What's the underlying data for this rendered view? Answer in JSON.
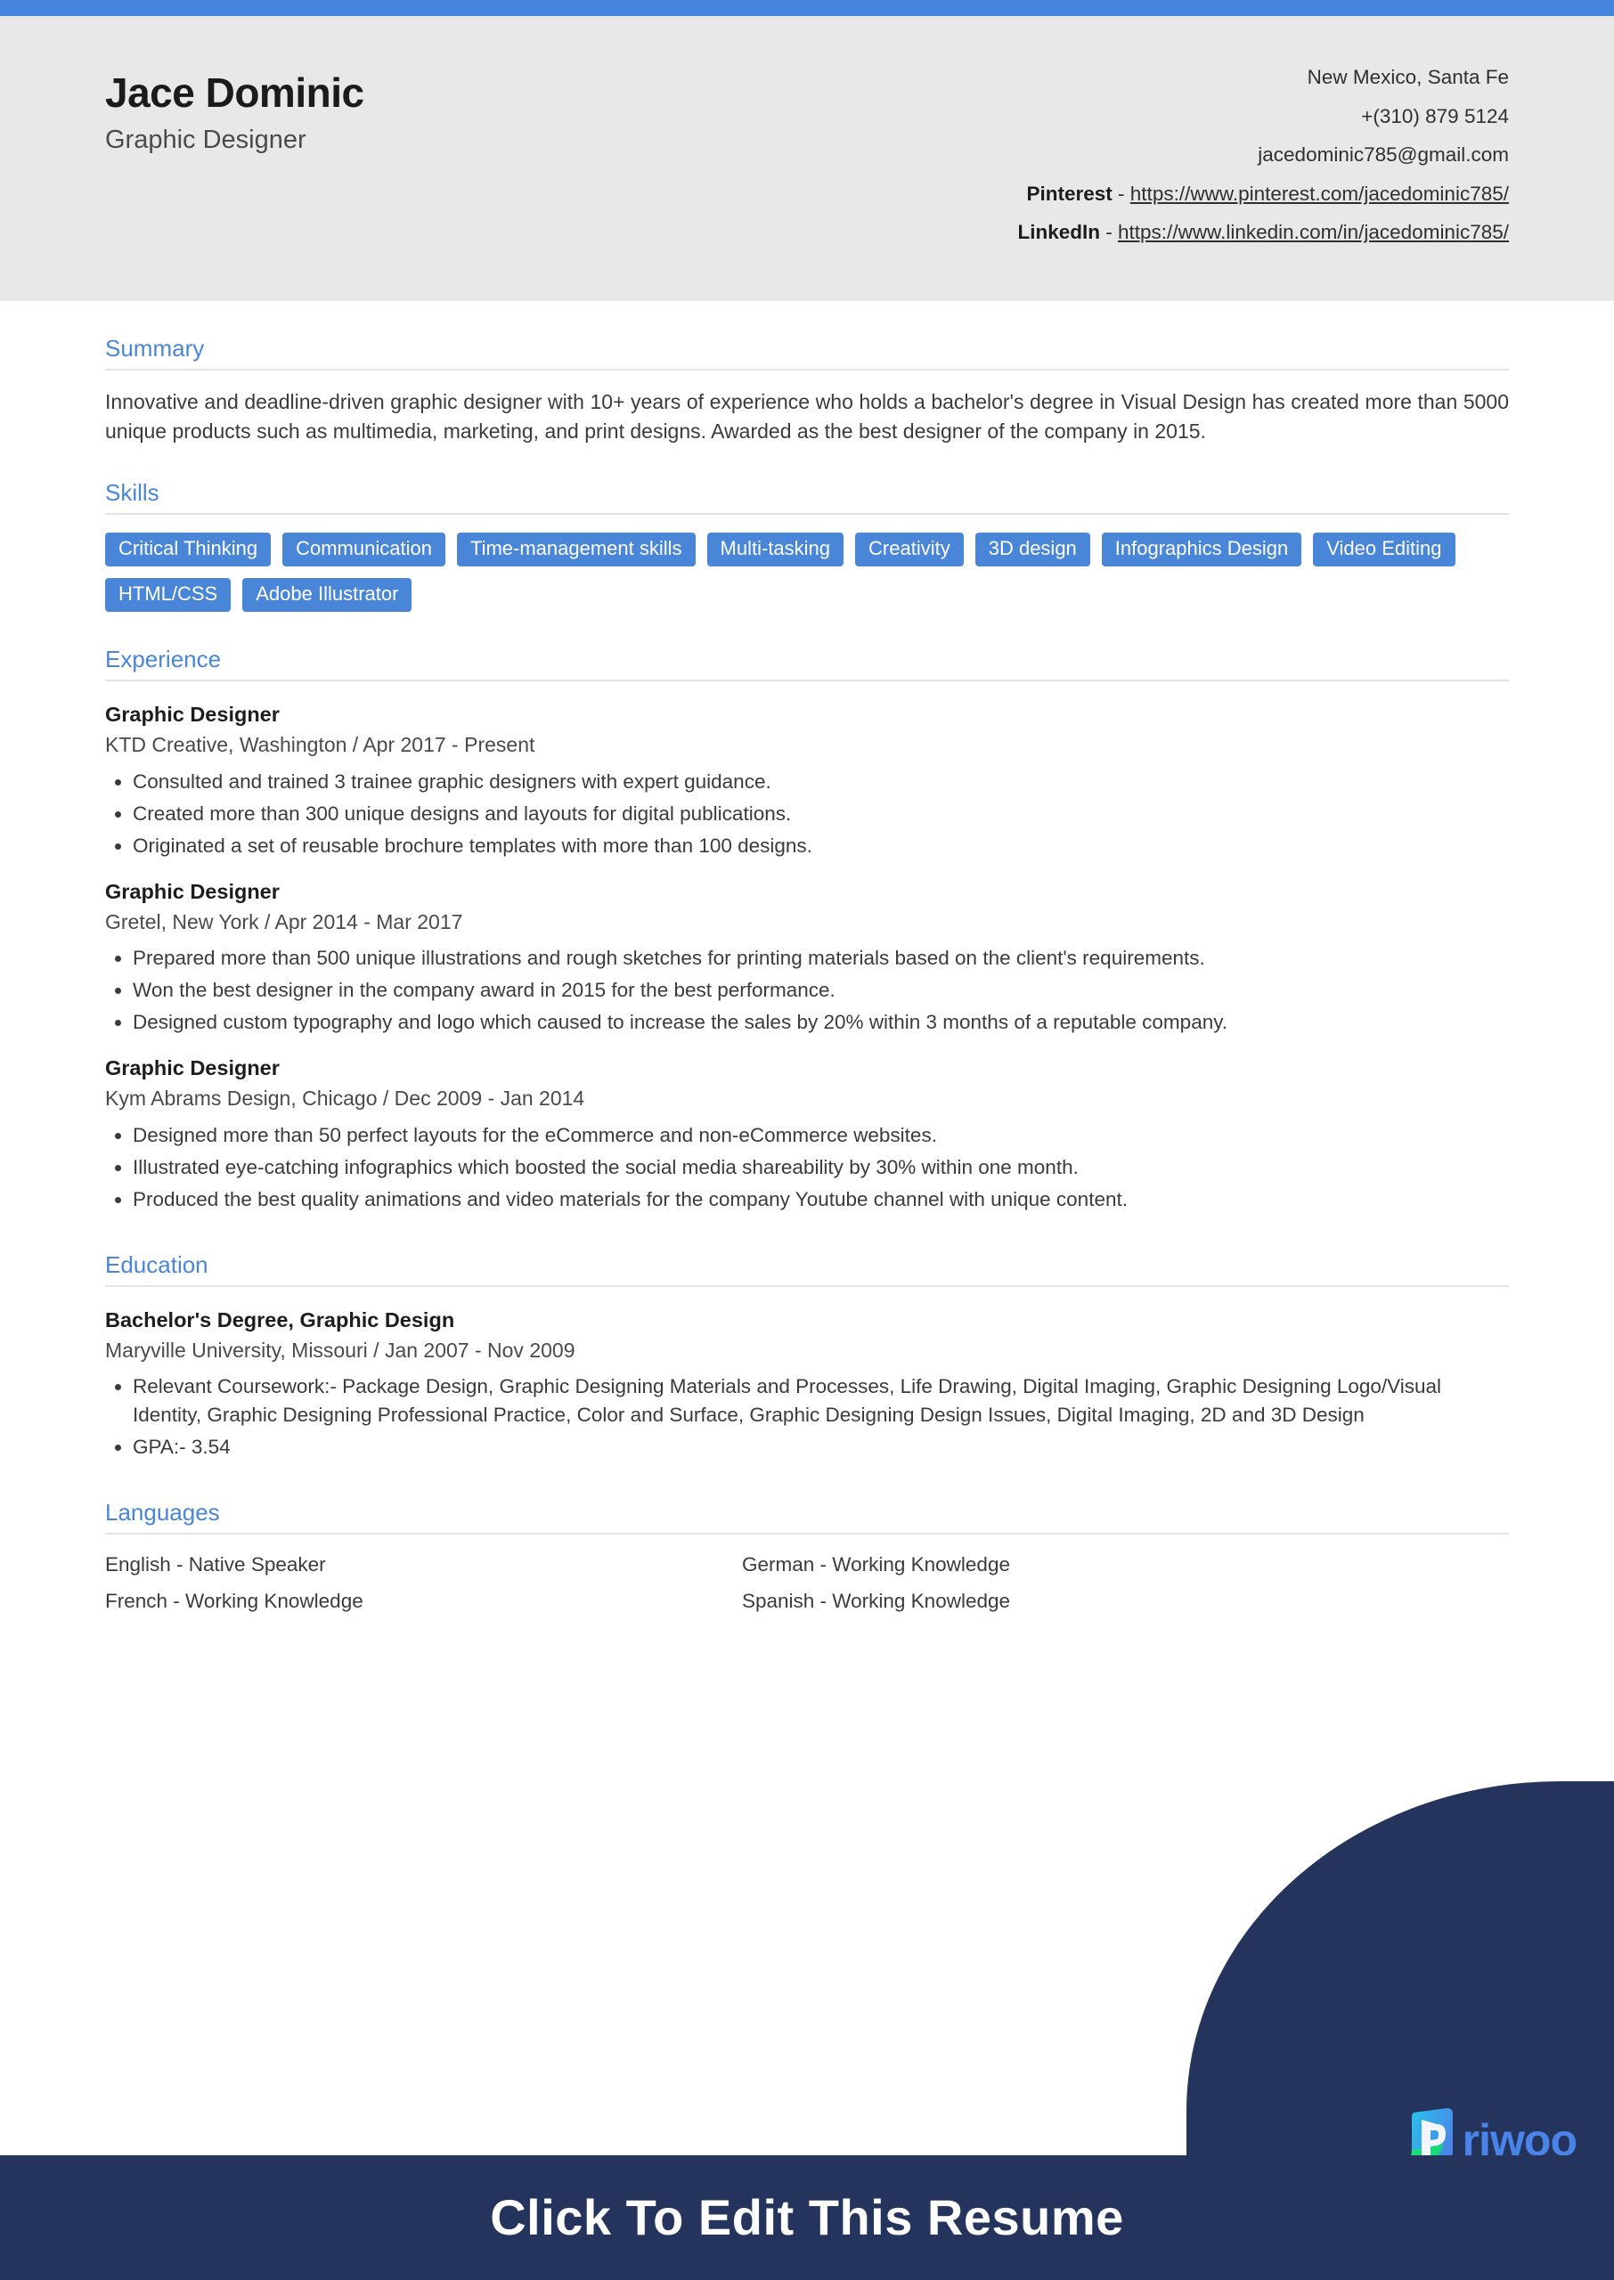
{
  "theme": {
    "accent_blue": "#4484dc",
    "heading_blue": "#4a86d8",
    "tag_blue": "#4a86d8",
    "header_bg": "#e8e8e8",
    "brand_navy": "#24345c",
    "brand_green": "#22dd80",
    "rule_gray": "#e3e3e3"
  },
  "header": {
    "name": "Jace Dominic",
    "job_title": "Graphic Designer",
    "location": "New Mexico, Santa Fe",
    "phone": "+(310) 879 5124",
    "email": "jacedominic785@gmail.com",
    "pinterest_label": "Pinterest",
    "pinterest_url": "https://www.pinterest.com/jacedominic785/",
    "linkedin_label": "LinkedIn",
    "linkedin_url": "https://www.linkedin.com/in/jacedominic785/",
    "separator": " - "
  },
  "sections": {
    "summary": {
      "heading": "Summary",
      "text": "Innovative and deadline-driven graphic designer with 10+ years of experience who holds a bachelor's degree in Visual Design has created more than 5000 unique products such as multimedia, marketing, and print designs. Awarded as the best designer of the company in 2015."
    },
    "skills": {
      "heading": "Skills",
      "items": [
        "Critical Thinking",
        "Communication",
        "Time-management skills",
        "Multi-tasking",
        "Creativity",
        "3D design",
        "Infographics Design",
        "Video Editing",
        "HTML/CSS",
        "Adobe Illustrator"
      ]
    },
    "experience": {
      "heading": "Experience",
      "entries": [
        {
          "title": "Graphic Designer",
          "meta": "KTD Creative, Washington / Apr 2017 - Present",
          "bullets": [
            "Consulted and trained 3 trainee graphic designers with expert guidance.",
            "Created more than 300 unique designs and layouts for digital publications.",
            "Originated a set of reusable brochure templates with more than 100 designs."
          ]
        },
        {
          "title": "Graphic Designer",
          "meta": "Gretel, New York / Apr 2014 - Mar 2017",
          "bullets": [
            "Prepared more than 500 unique illustrations and rough sketches for printing materials based on the client's requirements.",
            "Won the best designer in the company award in 2015 for the best performance.",
            "Designed custom typography and logo which caused to increase the sales by 20% within 3 months of a reputable company."
          ]
        },
        {
          "title": "Graphic Designer",
          "meta": "Kym Abrams Design, Chicago / Dec 2009 - Jan 2014",
          "bullets": [
            "Designed more than 50 perfect layouts for the eCommerce and non-eCommerce websites.",
            "Illustrated eye-catching infographics which boosted the social media shareability by 30% within one month.",
            "Produced the best quality animations and video materials for the company Youtube channel with unique content."
          ]
        }
      ]
    },
    "education": {
      "heading": "Education",
      "entries": [
        {
          "title": "Bachelor's Degree, Graphic Design",
          "meta": "Maryville University, Missouri / Jan 2007 - Nov 2009",
          "bullets": [
            "Relevant Coursework:- Package Design, Graphic Designing Materials and Processes, Life Drawing, Digital Imaging, Graphic Designing Logo/Visual Identity, Graphic Designing Professional Practice, Color and Surface, Graphic Designing Design Issues, Digital Imaging, 2D and 3D Design",
            "GPA:- 3.54"
          ]
        }
      ]
    },
    "languages": {
      "heading": "Languages",
      "items": [
        "English - Native Speaker",
        "German - Working Knowledge",
        "French - Working Knowledge",
        "Spanish - Working Knowledge"
      ]
    }
  },
  "branding": {
    "logo_text": "riwoo",
    "logo_mark_letter": "P"
  },
  "cta": {
    "label": "Click To Edit This Resume"
  }
}
